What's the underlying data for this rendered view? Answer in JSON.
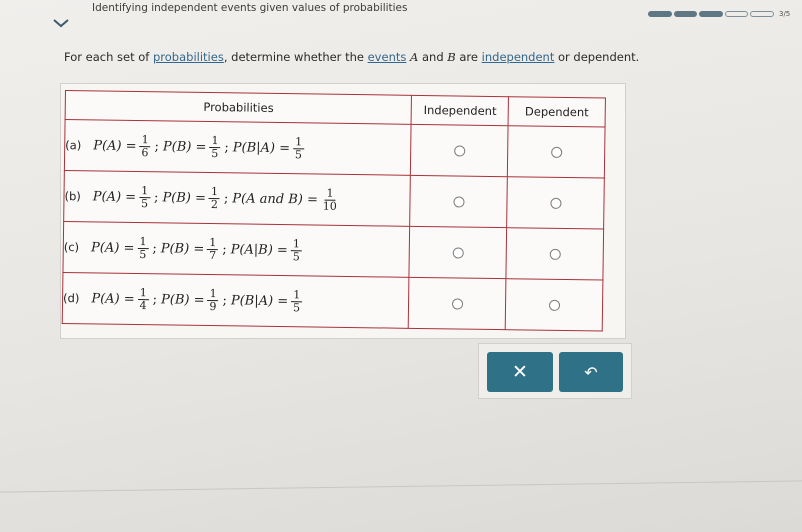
{
  "header": {
    "topic": "Identifying independent events given values of probabilities",
    "progress_label": "3/5",
    "progress": {
      "filled": 3,
      "total": 5
    }
  },
  "instruction": {
    "part1": "For each set of ",
    "link1": "probabilities",
    "part2": ", determine whether the ",
    "link2": "events",
    "varA": "A",
    "part3": " and ",
    "varB": "B",
    "part4": " are ",
    "link3": "independent",
    "part5": " or dependent."
  },
  "table": {
    "headers": [
      "Probabilities",
      "Independent",
      "Dependent"
    ],
    "rows": [
      {
        "label": "(a)",
        "p_a": {
          "num": "1",
          "den": "6"
        },
        "p_b": {
          "num": "1",
          "den": "5"
        },
        "third_text": "P(B|A) =",
        "third": {
          "num": "1",
          "den": "5"
        }
      },
      {
        "label": "(b)",
        "p_a": {
          "num": "1",
          "den": "5"
        },
        "p_b": {
          "num": "1",
          "den": "2"
        },
        "third_text": "P(A and B) =",
        "third": {
          "num": "1",
          "den": "10"
        }
      },
      {
        "label": "(c)",
        "p_a": {
          "num": "1",
          "den": "5"
        },
        "p_b": {
          "num": "1",
          "den": "7"
        },
        "third_text": "P(A|B) =",
        "third": {
          "num": "1",
          "den": "5"
        }
      },
      {
        "label": "(d)",
        "p_a": {
          "num": "1",
          "den": "4"
        },
        "p_b": {
          "num": "1",
          "den": "9"
        },
        "third_text": "P(B|A) =",
        "third": {
          "num": "1",
          "den": "5"
        }
      }
    ],
    "pa_text": "P(A) =",
    "pb_text": "P(B) ="
  },
  "buttons": {
    "clear_glyph": "✕",
    "undo_glyph": "↶"
  },
  "icons": [
    "chevron-down-icon",
    "close-icon",
    "undo-icon"
  ],
  "colors": {
    "accent": "#2f7287",
    "table_border": "#a8323a",
    "link": "#33678c"
  }
}
